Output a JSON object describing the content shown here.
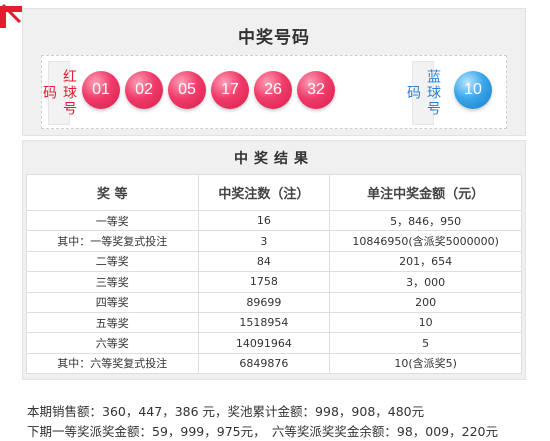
{
  "winning_numbers": {
    "title": "中奖号码",
    "red_label": "红球号码",
    "blue_label": "蓝球号码",
    "red_balls": [
      "01",
      "02",
      "05",
      "17",
      "26",
      "32"
    ],
    "blue_ball": "10"
  },
  "results": {
    "title": "中奖结果",
    "headers": [
      "奖 等",
      "中奖注数（注）",
      "单注中奖金额（元）"
    ],
    "rows": [
      [
        "一等奖",
        "16",
        "5，846，950"
      ],
      [
        "其中：一等奖复式投注",
        "3",
        "10846950(含派奖5000000)"
      ],
      [
        "二等奖",
        "84",
        "201，654"
      ],
      [
        "三等奖",
        "1758",
        "3，000"
      ],
      [
        "四等奖",
        "89699",
        "200"
      ],
      [
        "五等奖",
        "1518954",
        "10"
      ],
      [
        "六等奖",
        "14091964",
        "5"
      ],
      [
        "其中：六等奖复式投注",
        "6849876",
        "10(含派奖5)"
      ]
    ]
  },
  "summary": {
    "line1": "本期销售额：360，447，386 元，奖池累计金额：998，908，480元",
    "line2": "下期一等奖派奖金额：59，999，975元，　六等奖派奖奖金余额：98，009，220元"
  },
  "colors": {
    "red_ball": "#e8305f",
    "blue_ball": "#2a93de",
    "accent": "#e11d2e"
  }
}
